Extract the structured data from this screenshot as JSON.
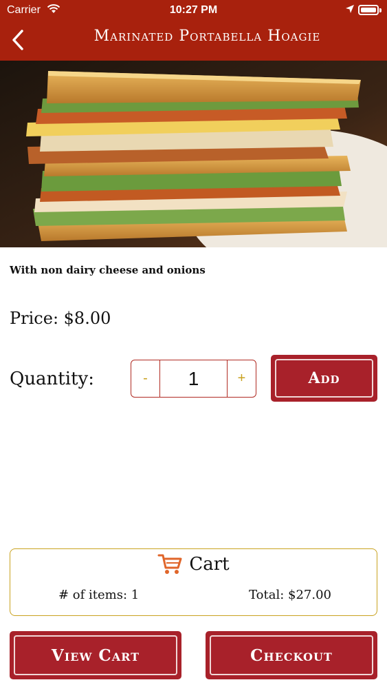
{
  "status_bar": {
    "carrier": "Carrier",
    "time": "10:27 PM",
    "icons": [
      "wifi-icon",
      "location-arrow-icon",
      "battery-icon"
    ]
  },
  "nav": {
    "title": "Marinated Portabella Hoagie",
    "back_icon": "chevron-left-icon"
  },
  "product": {
    "image": "sandwich-photo",
    "description": "With non dairy cheese and onions",
    "price_text": "Price: $8.00"
  },
  "quantity": {
    "label": "Quantity:",
    "minus": "-",
    "value": "1",
    "plus": "+",
    "add_label": "Add"
  },
  "cart": {
    "icon": "shopping-cart-icon",
    "title": "Cart",
    "items_text": "# of items: 1",
    "total_text": "Total: $27.00"
  },
  "actions": {
    "view_cart": "View Cart",
    "checkout": "Checkout"
  },
  "colors": {
    "header": "#a8210d",
    "button": "#a8212a",
    "accent_gold": "#c9a21f",
    "cart_icon": "#e0662a"
  }
}
